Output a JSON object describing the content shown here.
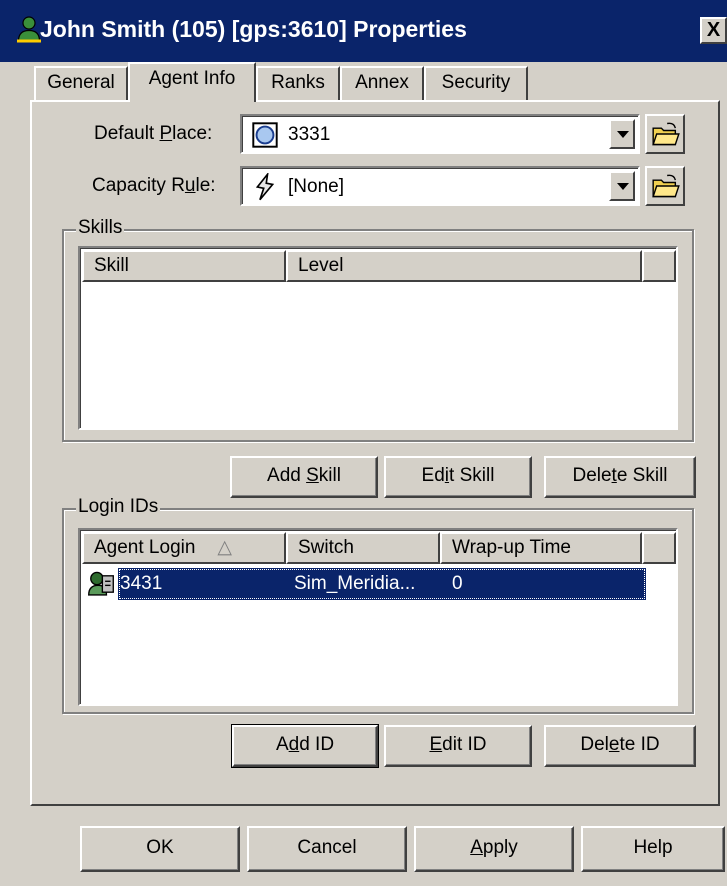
{
  "window": {
    "title": "John Smith (105) [gps:3610] Properties",
    "close_label": "X"
  },
  "tabs": [
    {
      "label": "General",
      "active": false
    },
    {
      "label": "Agent Info",
      "active": true
    },
    {
      "label": "Ranks",
      "active": false
    },
    {
      "label": "Annex",
      "active": false
    },
    {
      "label": "Security",
      "active": false
    }
  ],
  "form": {
    "default_place": {
      "label_pre": "Default ",
      "label_u": "P",
      "label_post": "lace:",
      "value": "3331"
    },
    "capacity_rule": {
      "label_pre": "Capacity R",
      "label_u": "u",
      "label_post": "le:",
      "value": "[None]"
    }
  },
  "skills": {
    "group_title": "Skills",
    "columns": [
      "Skill",
      "Level"
    ],
    "rows": [],
    "buttons": {
      "add": {
        "pre": "Add ",
        "u": "S",
        "post": "kill"
      },
      "edit": {
        "pre": "Ed",
        "u": "i",
        "post": "t Skill"
      },
      "delete": {
        "pre": "Dele",
        "u": "t",
        "post": "e Skill"
      }
    }
  },
  "login_ids": {
    "group_title": "Login IDs",
    "columns": [
      "Agent Login",
      "Switch",
      "Wrap-up Time"
    ],
    "sort_indicator": "△",
    "rows": [
      {
        "agent_login": "3431",
        "switch": "Sim_Meridia...",
        "wrapup": "0",
        "selected": true
      }
    ],
    "buttons": {
      "add": {
        "pre": "A",
        "u": "d",
        "post": "d ID"
      },
      "edit": {
        "pre": "",
        "u": "E",
        "post": "dit ID"
      },
      "delete": {
        "pre": "Del",
        "u": "e",
        "post": "te ID"
      }
    }
  },
  "dialog_buttons": {
    "ok": "OK",
    "cancel": "Cancel",
    "apply": {
      "pre": "",
      "u": "A",
      "post": "pply"
    },
    "help": "Help"
  },
  "colors": {
    "titlebar": "#0a246a",
    "selection": "#0a246a",
    "face": "#d4d0c8"
  },
  "icons": [
    "agent-icon",
    "place-icon",
    "capacity-rule-icon",
    "folder-open-icon",
    "login-id-icon"
  ]
}
